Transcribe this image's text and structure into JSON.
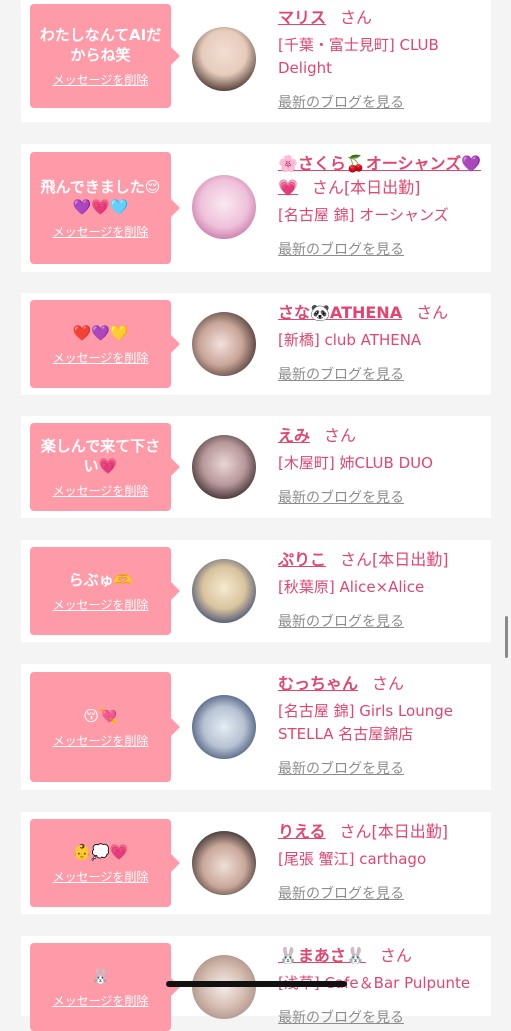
{
  "cards": [
    {
      "message": "わたしなんてAIだからね笑",
      "delete_label": "メッセージを削除",
      "name": "マリス",
      "san": "さん",
      "status": "",
      "shop": "[千葉・富士見町] CLUB Delight",
      "blog_label": "最新のブログを見る",
      "avatar_colors": [
        "#e9d7cc",
        "#5a4438"
      ]
    },
    {
      "message": "飛んできました😌💜💗🩵",
      "delete_label": "メッセージを削除",
      "name": "🌸さくら🍒オーシャンズ💜💗",
      "san": "さん",
      "status": "[本日出勤]",
      "shop": "[名古屋 錦] オーシャンズ",
      "blog_label": "最新のブログを見る",
      "avatar_colors": [
        "#f7e3ee",
        "#d86aa8"
      ]
    },
    {
      "message": "❤️💜💛",
      "delete_label": "メッセージを削除",
      "name": "さな🐼ATHENA",
      "san": "さん",
      "status": "",
      "shop": "[新橋] club ATHENA",
      "blog_label": "最新のブログを見る",
      "avatar_colors": [
        "#e2c6b9",
        "#3a2a26"
      ]
    },
    {
      "message": "楽しんで来て下さい💗",
      "delete_label": "メッセージを削除",
      "name": "えみ",
      "san": "さん",
      "status": "",
      "shop": "[木屋町] 姉CLUB DUO",
      "blog_label": "最新のブログを見る",
      "avatar_colors": [
        "#d9c3c4",
        "#2b1f22"
      ]
    },
    {
      "message": "らぶゅ🫶",
      "delete_label": "メッセージを削除",
      "name": "ぷりこ",
      "san": "さん",
      "status": "[本日出勤]",
      "shop": "[秋葉原] Alice×Alice",
      "blog_label": "最新のブログを見る",
      "avatar_colors": [
        "#f0e4c8",
        "#2e3e6e"
      ]
    },
    {
      "message": "😚💘",
      "delete_label": "メッセージを削除",
      "name": "むっちゃん",
      "san": "さん",
      "status": "",
      "shop": "[名古屋 錦] Girls Lounge STELLA 名古屋錦店",
      "blog_label": "最新のブログを見る",
      "avatar_colors": [
        "#cdd8e6",
        "#3a4a6a"
      ]
    },
    {
      "message": "👶💭💗",
      "delete_label": "メッセージを削除",
      "name": "りえる",
      "san": "さん",
      "status": "[本日出勤]",
      "shop": "[尾張 蟹江] carthago",
      "blog_label": "最新のブログを見る",
      "avatar_colors": [
        "#e7d6cf",
        "#1d1d1d"
      ]
    },
    {
      "message": "🐰",
      "delete_label": "メッセージを削除",
      "name": "🐰まあさ🐰",
      "san": "さん",
      "status": "",
      "shop": "[浅草] Cafe＆Bar Pulpunte",
      "blog_label": "最新のブログを見る",
      "avatar_colors": [
        "#efe6e2",
        "#b89a8e"
      ]
    }
  ]
}
